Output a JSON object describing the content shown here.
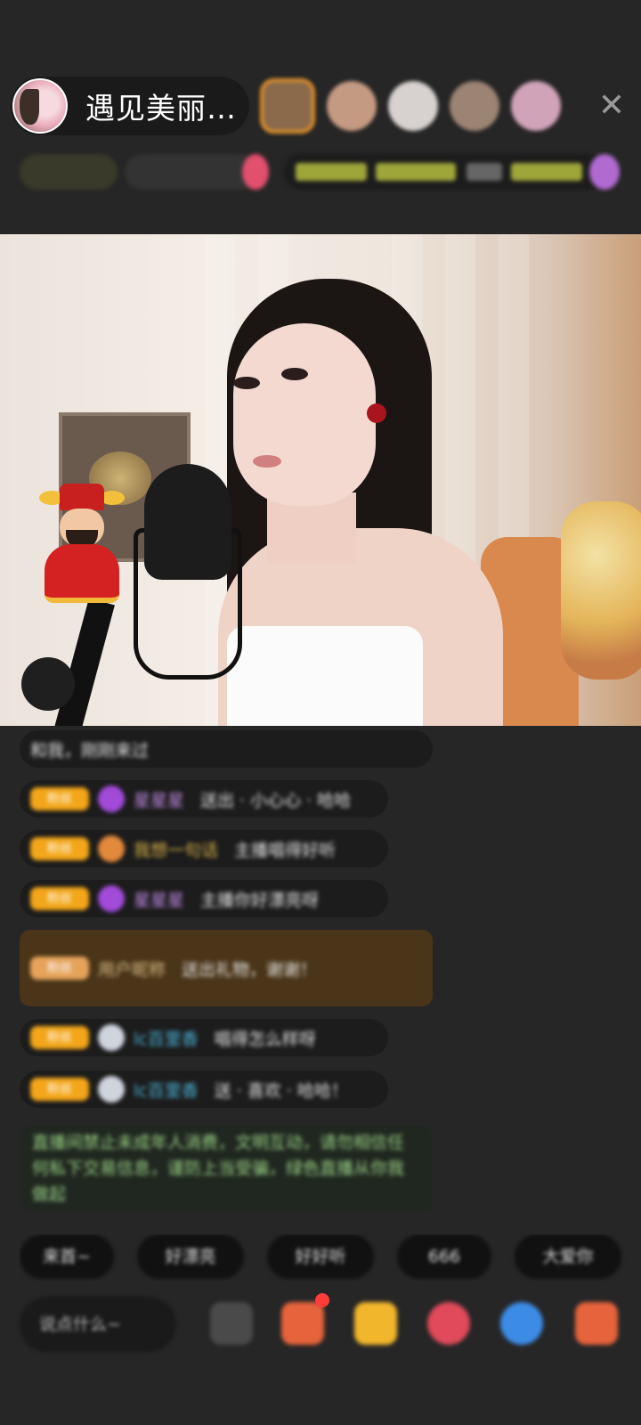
{
  "header": {
    "host_name": "遇见美丽…",
    "close_icon": "close-icon",
    "viewers": [
      {
        "name": "viewer-1",
        "color": "#8a6a4a"
      },
      {
        "name": "viewer-2",
        "color": "#c59a82"
      },
      {
        "name": "viewer-3",
        "color": "#d7d2cf"
      },
      {
        "name": "viewer-4",
        "color": "#9c8474"
      },
      {
        "name": "viewer-5",
        "color": "#d1a3b8"
      }
    ]
  },
  "chat": {
    "messages": [
      {
        "kind": "plain",
        "text": "和我，刚刚来过"
      },
      {
        "kind": "user",
        "badge": "粉丝",
        "icon": "diamond",
        "user": "星星星",
        "text": "送出 · 小心心 · 哈哈"
      },
      {
        "kind": "user",
        "badge": "粉丝",
        "icon": "orange",
        "user": "我想一句话",
        "text": "主播唱得好听"
      },
      {
        "kind": "user",
        "badge": "粉丝",
        "icon": "diamond",
        "user": "星星星",
        "text": "主播你好漂亮呀"
      },
      {
        "kind": "gift",
        "badge": "粉丝",
        "user": "用户昵称",
        "text": "送出礼物，谢谢！"
      },
      {
        "kind": "user",
        "badge": "粉丝",
        "icon": "cloud",
        "user": "lc百里香",
        "text": "唱得怎么样呀"
      },
      {
        "kind": "user",
        "badge": "粉丝",
        "icon": "cloud",
        "user": "lc百里香",
        "text": "送 · 喜欢 · 哈哈！"
      },
      {
        "kind": "system",
        "text": "直播间禁止未成年人消费，文明互动，请勿相信任何私下交易信息，谨防上当受骗，绿色直播从你我做起"
      }
    ]
  },
  "quick_replies": [
    "来首~",
    "好漂亮",
    "好好听",
    "666",
    "大爱你"
  ],
  "bottom_bar": {
    "input_placeholder": "说点什么~",
    "icons": [
      {
        "name": "more-icon",
        "color": "#5a5a5a"
      },
      {
        "name": "gift-box-icon",
        "color": "#e6633c"
      },
      {
        "name": "red-packet-icon",
        "color": "#f2b62c"
      },
      {
        "name": "heart-icon",
        "color": "#e04a5a"
      },
      {
        "name": "game-icon",
        "color": "#3c8ce6"
      },
      {
        "name": "gift-icon",
        "color": "#e6633c"
      }
    ]
  }
}
